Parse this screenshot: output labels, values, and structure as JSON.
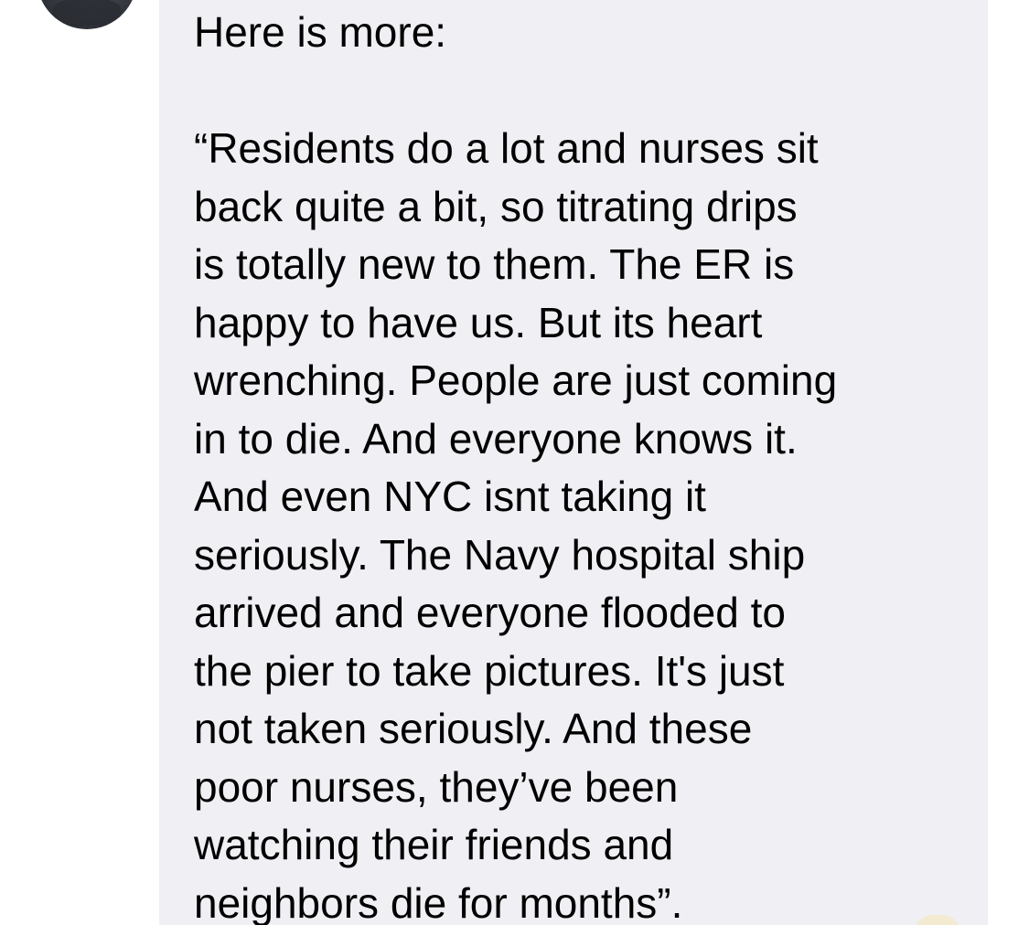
{
  "conversation": {
    "message": {
      "intro_line": "Here is more:",
      "body_lines": [
        "“Residents do a lot and nurses sit",
        "back quite a bit, so titrating drips",
        "is totally new to them. The ER is",
        "happy to have us. But its heart",
        "wrenching. People are just coming",
        "in to die. And everyone knows it.",
        "And even NYC isnt taking it",
        "seriously. The Navy hospital ship",
        "arrived and everyone flooded to",
        "the pier to take pictures. It's just",
        "not taken seriously. And these",
        "poor nurses, they’ve been",
        "watching their friends and",
        "neighbors die for months”."
      ]
    },
    "colors": {
      "bubble_background": "#efeff4",
      "text": "#000000",
      "page_background": "#ffffff"
    }
  }
}
